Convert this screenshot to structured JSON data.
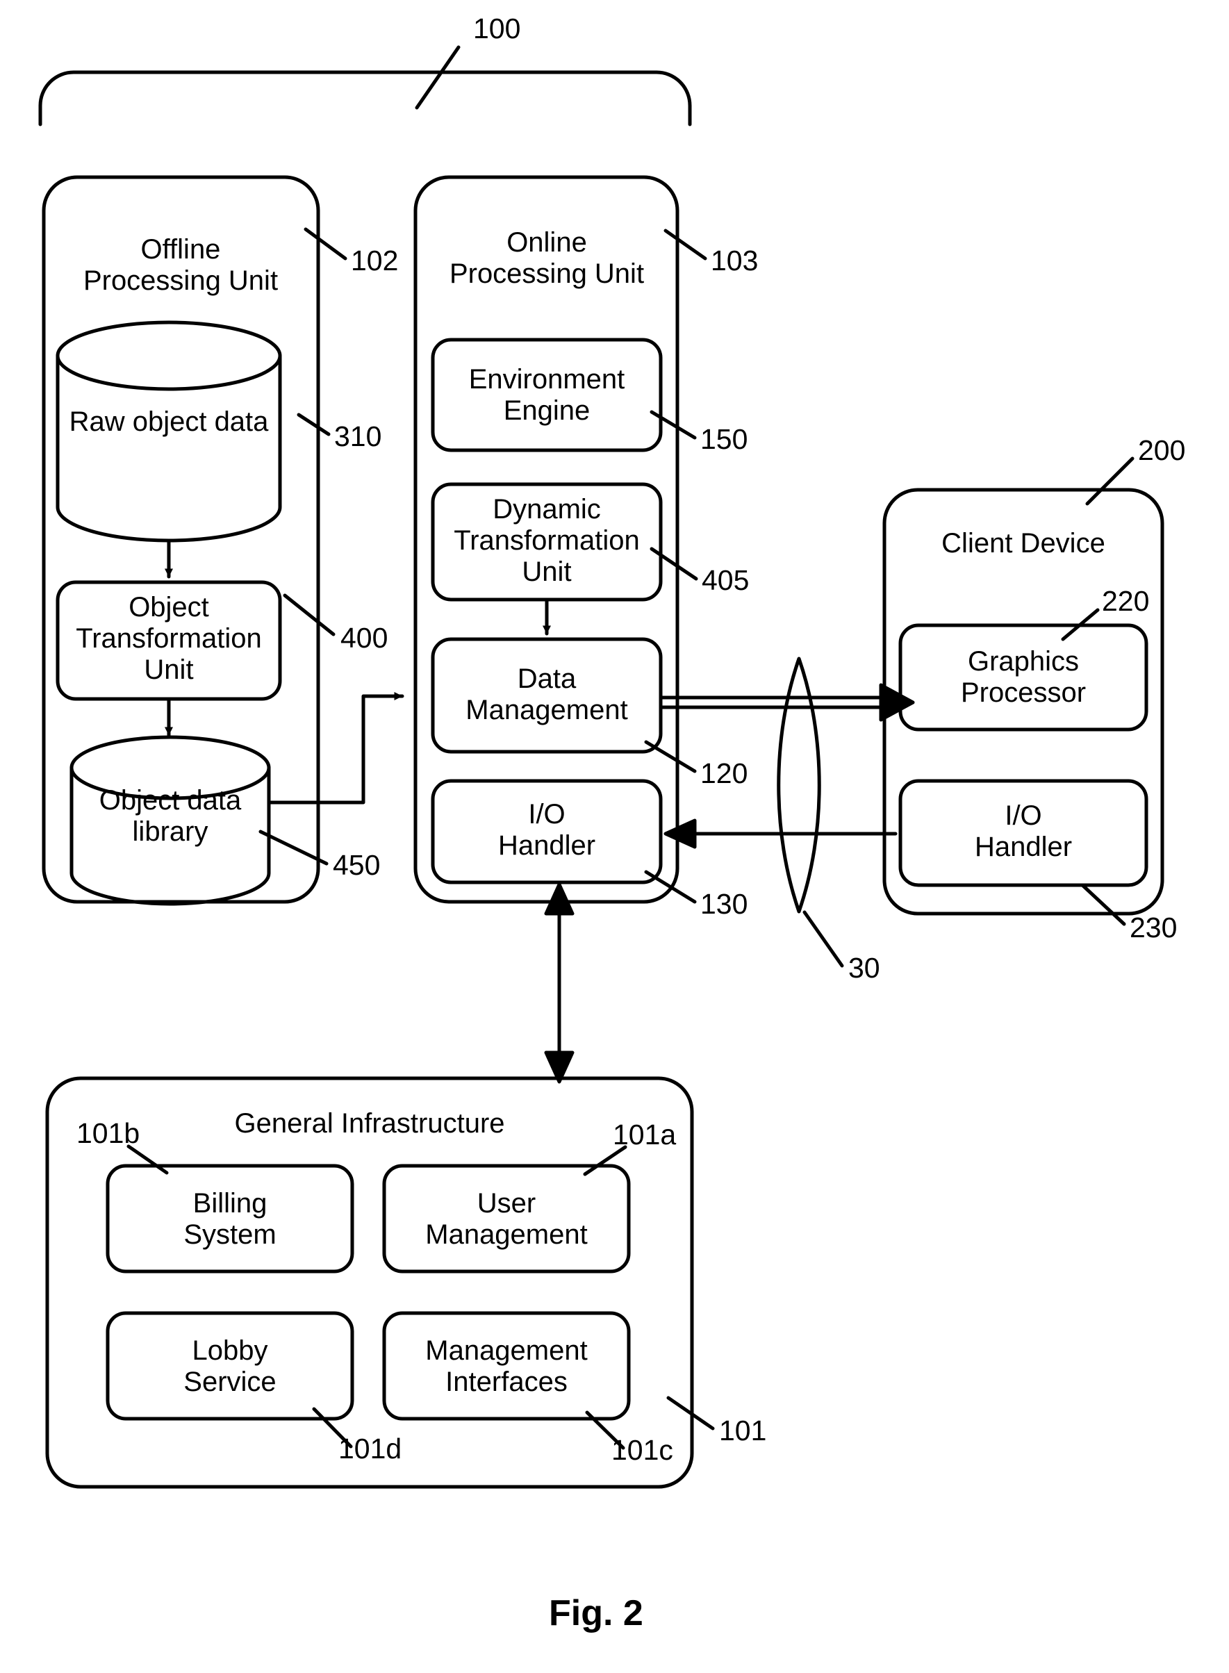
{
  "figure": {
    "caption": "Fig. 2",
    "system_ref": "100"
  },
  "offline_unit": {
    "title": "Offline\nProcessing Unit",
    "ref": "102",
    "nodes": [
      {
        "label": "Raw object data",
        "ref": "310",
        "shape": "cylinder"
      },
      {
        "label": "Object\nTransformation\nUnit",
        "ref": "400",
        "shape": "rounded-rect"
      },
      {
        "label": "Object data\nlibrary",
        "ref": "450",
        "shape": "cylinder"
      }
    ]
  },
  "online_unit": {
    "title": "Online\nProcessing Unit",
    "ref": "103",
    "nodes": [
      {
        "label": "Environment\nEngine",
        "ref": "150",
        "shape": "rounded-rect"
      },
      {
        "label": "Dynamic\nTransformation\nUnit",
        "ref": "405",
        "shape": "rounded-rect"
      },
      {
        "label": "Data\nManagement",
        "ref": "120",
        "shape": "rounded-rect"
      },
      {
        "label": "I/O\nHandler",
        "ref": "130",
        "shape": "rounded-rect"
      }
    ]
  },
  "network": {
    "ref": "30",
    "shape": "lens"
  },
  "client_device": {
    "title": "Client Device",
    "ref": "200",
    "nodes": [
      {
        "label": "Graphics\nProcessor",
        "ref": "220",
        "shape": "rounded-rect"
      },
      {
        "label": "I/O\nHandler",
        "ref": "230",
        "shape": "rounded-rect"
      }
    ]
  },
  "general_infrastructure": {
    "title": "General Infrastructure",
    "ref": "101",
    "nodes": [
      {
        "label": "Billing\nSystem",
        "ref": "101b",
        "shape": "rounded-rect"
      },
      {
        "label": "User\nManagement",
        "ref": "101a",
        "shape": "rounded-rect"
      },
      {
        "label": "Lobby\nService",
        "ref": "101d",
        "shape": "rounded-rect"
      },
      {
        "label": "Management\nInterfaces",
        "ref": "101c",
        "shape": "rounded-rect"
      }
    ]
  },
  "colors": {
    "stroke": "#000000",
    "background": "#ffffff"
  }
}
